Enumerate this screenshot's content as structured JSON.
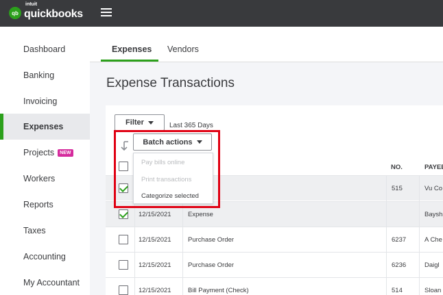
{
  "app": {
    "logo_brand": "intuit",
    "logo_text": "quickbooks",
    "logo_badge": "qb"
  },
  "sidebar": {
    "items": [
      {
        "label": "Dashboard"
      },
      {
        "label": "Banking"
      },
      {
        "label": "Invoicing"
      },
      {
        "label": "Expenses",
        "active": true
      },
      {
        "label": "Projects",
        "badge": "NEW"
      },
      {
        "label": "Workers"
      },
      {
        "label": "Reports"
      },
      {
        "label": "Taxes"
      },
      {
        "label": "Accounting"
      },
      {
        "label": "My Accountant"
      }
    ]
  },
  "tabs": [
    {
      "label": "Expenses",
      "active": true
    },
    {
      "label": "Vendors"
    }
  ],
  "page": {
    "title": "Expense Transactions"
  },
  "filter": {
    "button_label": "Filter",
    "date_range": "Last 365 Days"
  },
  "batch_actions": {
    "button_label": "Batch actions",
    "menu": [
      {
        "label": "Pay bills online",
        "enabled": false
      },
      {
        "label": "Print transactions",
        "enabled": false
      },
      {
        "label": "Categorize selected",
        "enabled": true
      }
    ]
  },
  "table": {
    "columns": {
      "no": "NO.",
      "payee": "PAYEE"
    },
    "rows": [
      {
        "date": "",
        "type": "",
        "no": "515",
        "payee": "Vu Co",
        "checked": true
      },
      {
        "date": "12/15/2021",
        "type": "Expense",
        "no": "",
        "payee": "Baysh",
        "checked": true
      },
      {
        "date": "12/15/2021",
        "type": "Purchase Order",
        "no": "6237",
        "payee": "A Che",
        "checked": false
      },
      {
        "date": "12/15/2021",
        "type": "Purchase Order",
        "no": "6236",
        "payee": "Daigl",
        "checked": false
      },
      {
        "date": "12/15/2021",
        "type": "Bill Payment (Check)",
        "no": "514",
        "payee": "Sloan",
        "checked": false
      }
    ]
  },
  "colors": {
    "accent_green": "#2ca01c",
    "topbar": "#393a3d",
    "highlight_red": "#e00012",
    "new_badge": "#d52b9d"
  }
}
